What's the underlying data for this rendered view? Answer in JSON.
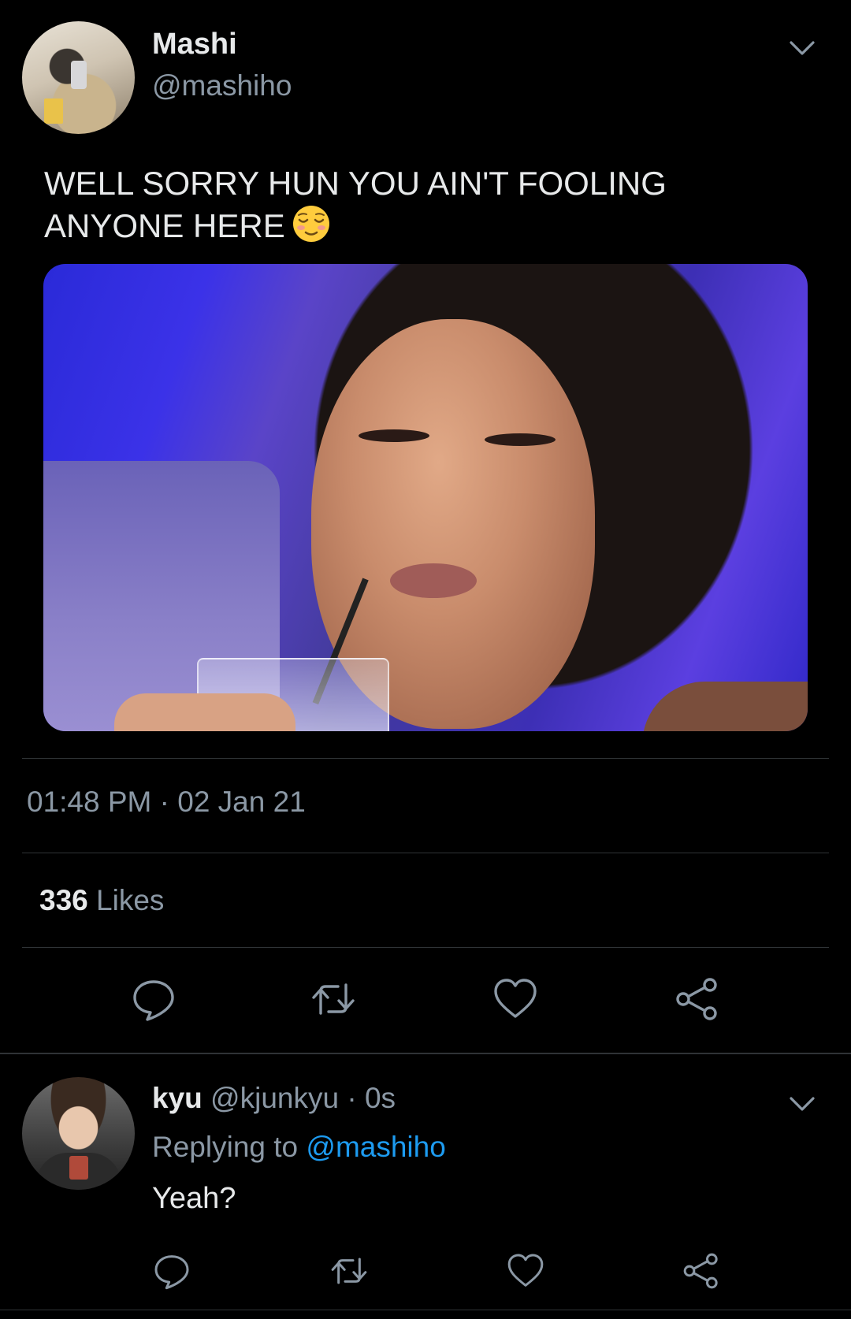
{
  "tweet": {
    "author_name": "Mashi",
    "author_handle": "@mashiho",
    "text": "WELL SORRY HUN YOU AIN'T FOOLING ANYONE HERE",
    "emoji_icon": "relieved-face-icon",
    "timestamp": "01:48 PM · 02 Jan 21",
    "likes_count": "336",
    "likes_label": "Likes",
    "actions": [
      "reply-icon",
      "retweet-icon",
      "like-icon",
      "share-icon"
    ]
  },
  "reply": {
    "author_name": "kyu",
    "meta": "@kjunkyu · 0s",
    "replying_to_prefix": "Replying to",
    "replying_to_handle": "@mashiho",
    "text": "Yeah?",
    "actions": [
      "reply-icon",
      "retweet-icon",
      "like-icon",
      "share-icon"
    ]
  },
  "colors": {
    "background": "#000000",
    "primary_text": "#e7e9ea",
    "secondary_text": "#8b98a5",
    "link": "#1d9bf0",
    "divider": "#2f3336"
  }
}
